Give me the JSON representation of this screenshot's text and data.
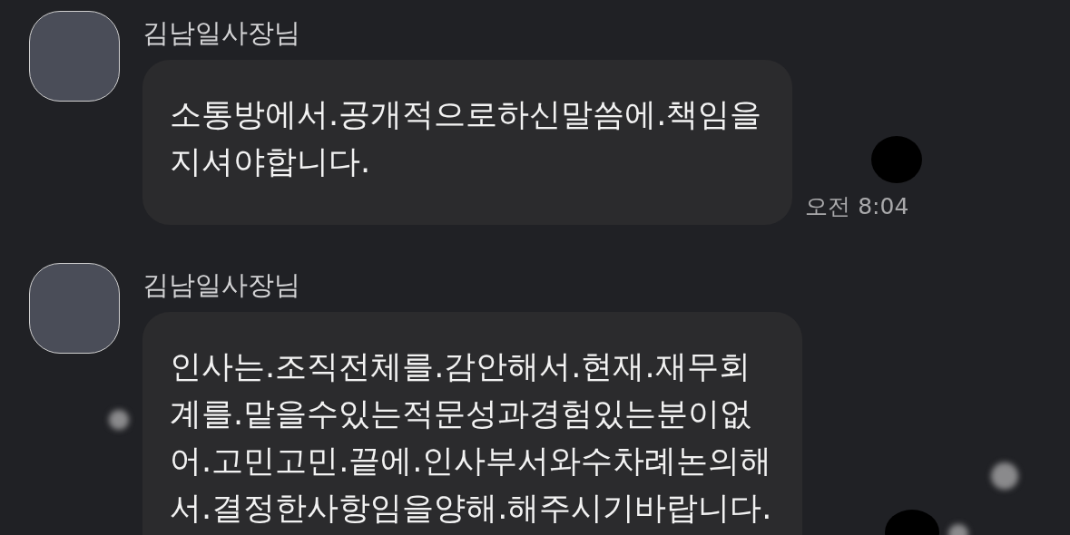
{
  "messages": [
    {
      "sender": "김남일사장님",
      "text": "소통방에서.공개적으로하신말씀에.책임을\n지셔야합니다.",
      "time": "오전 8:04"
    },
    {
      "sender": "김남일사장님",
      "text": "인사는.조직전체를.감안해서.현재.재무회\n계를.맡을수있는적문성과경험있는분이없\n어.고민고민.끝에.인사부서와수차례논의해\n서.결정한사항임을양해.해주시기바랍니다."
    }
  ]
}
